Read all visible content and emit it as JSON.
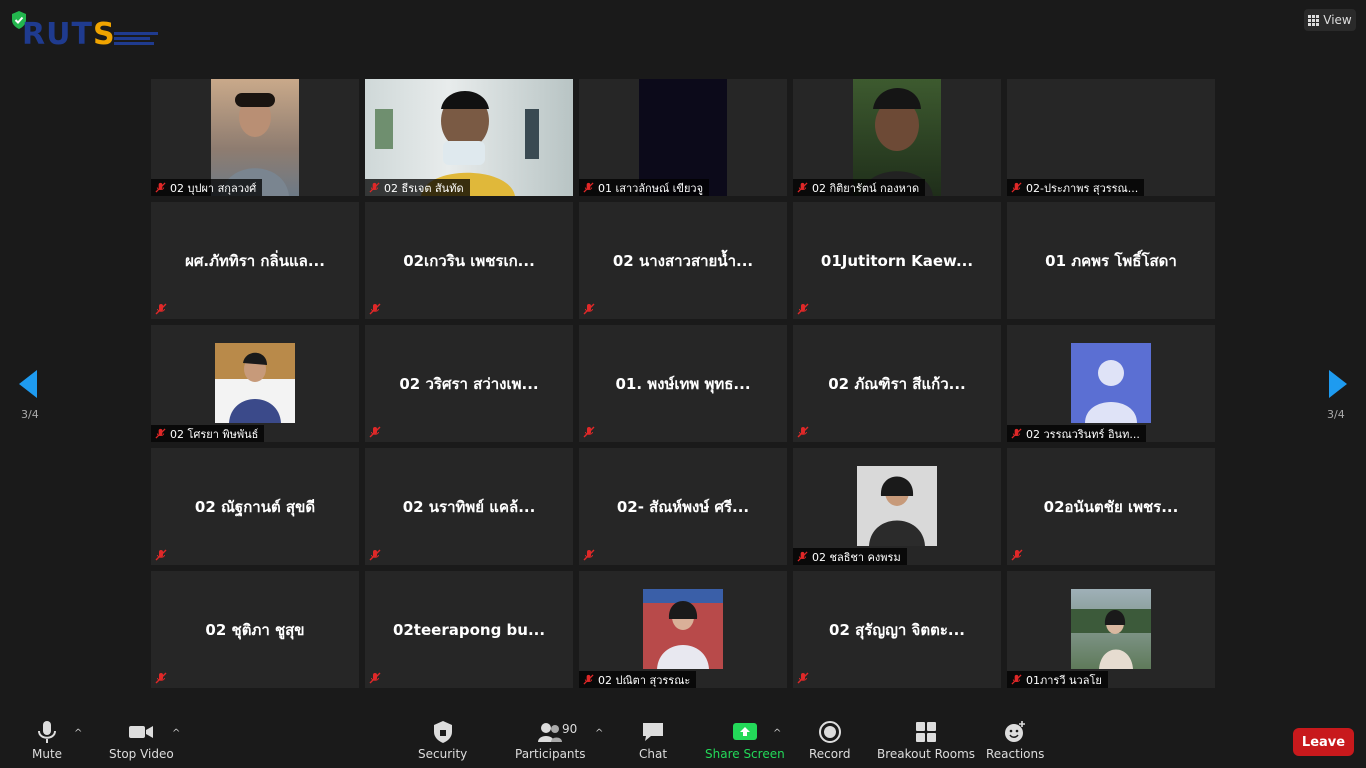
{
  "header": {
    "logo_text_1": "RUT",
    "logo_text_2": "S",
    "view_label": "View"
  },
  "nav": {
    "page_indicator": "3/4"
  },
  "participants_grid": [
    {
      "name": "02 บุปผา สกุลวงศ์",
      "video": true
    },
    {
      "name": "02 ธีรเจต สันทัด",
      "video": true
    },
    {
      "name": "01 เสาวลักษณ์ เขียวจู",
      "video": true
    },
    {
      "name": "02 กิติยารัตน์ กองหาด",
      "video": true
    },
    {
      "name": "02-ประภาพร สุวรรณ...",
      "video": false
    },
    {
      "name": "ผศ.ภัททิรา กลิ่นแล...",
      "video": false
    },
    {
      "name": "02เกวริน เพชรเก...",
      "video": false
    },
    {
      "name": "02 นางสาวสายน้ำ...",
      "video": false
    },
    {
      "name": "01Jutitorn Kaew...",
      "video": false
    },
    {
      "name": "01 ภคพร โพธิ์โสดา",
      "video": false
    },
    {
      "name": "02 โศรยา พิษพันธ์",
      "video": true
    },
    {
      "name": "02 วริศรา สว่างเพ...",
      "video": false
    },
    {
      "name": "01. พงษ์เทพ พุทธ...",
      "video": false
    },
    {
      "name": "02 ภัณฑิรา สีแก้ว...",
      "video": false
    },
    {
      "name": "02 วรรณวรินทร์ อินท...",
      "video": true
    },
    {
      "name": "02 ณัฐกานต์ สุขดี",
      "video": false
    },
    {
      "name": "02 นราทิพย์ แคล้...",
      "video": false
    },
    {
      "name": "02- สัณห์พงษ์ ศรี...",
      "video": false
    },
    {
      "name": "02 ชลธิชา คงพรม",
      "video": true
    },
    {
      "name": "02อนันตชัย เพชร...",
      "video": false
    },
    {
      "name": "02 ชุติภา ชูสุข",
      "video": false
    },
    {
      "name": "02teerapong bu...",
      "video": false
    },
    {
      "name": "02 ปณิตา สุวรรณะ",
      "video": true
    },
    {
      "name": "02 สุรัญญา จิตตะ...",
      "video": false
    },
    {
      "name": "01ภารวี นวลโย",
      "video": true
    }
  ],
  "toolbar": {
    "mute_label": "Mute",
    "stop_video_label": "Stop Video",
    "security_label": "Security",
    "participants_label": "Participants",
    "participants_count": "90",
    "chat_label": "Chat",
    "share_screen_label": "Share Screen",
    "record_label": "Record",
    "breakout_rooms_label": "Breakout Rooms",
    "reactions_label": "Reactions",
    "leave_label": "Leave"
  },
  "colors": {
    "accent": "#1e9bf0",
    "share_green": "#23d959",
    "leave_red": "#c8191c",
    "mute_red": "#e02828"
  }
}
